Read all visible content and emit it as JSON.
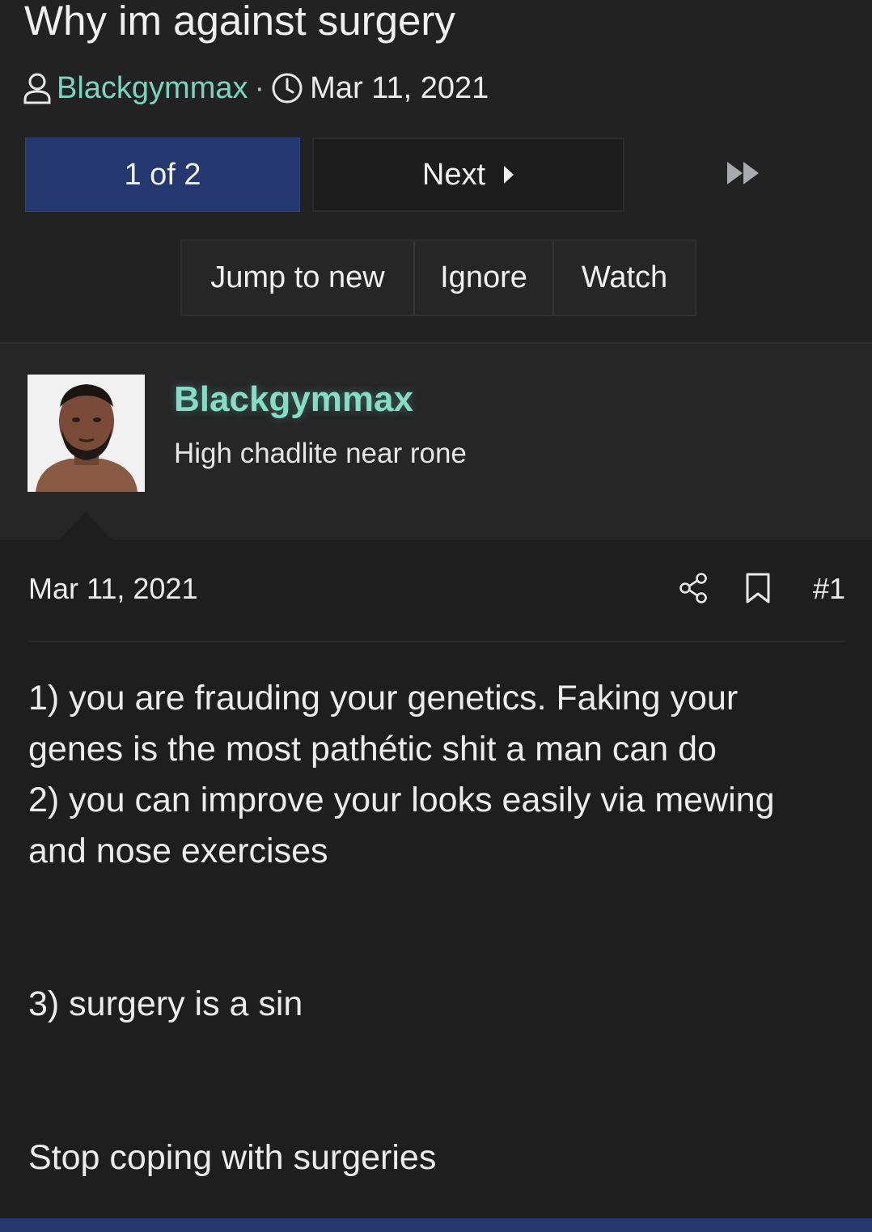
{
  "thread": {
    "title": "Why im against surgery",
    "author": "Blackgymmax",
    "separator": "·",
    "date": "Mar 11, 2021"
  },
  "pagination": {
    "current": "1 of 2",
    "next": "Next"
  },
  "actions": {
    "jump": "Jump to new",
    "ignore": "Ignore",
    "watch": "Watch"
  },
  "user": {
    "name": "Blackgymmax",
    "title": "High chadlite near rone"
  },
  "post": {
    "date": "Mar 11, 2021",
    "number": "#1",
    "lines": [
      "1) you are frauding your genetics. Faking your",
      "genes is the most pathétic shit a man can do",
      "2) you can improve your looks easily via mewing",
      "and nose exercises",
      "3) surgery is a sin",
      "Stop coping with surgeries"
    ]
  },
  "colors": {
    "accent_green": "#79d6bd",
    "pager_blue": "#24386f"
  }
}
